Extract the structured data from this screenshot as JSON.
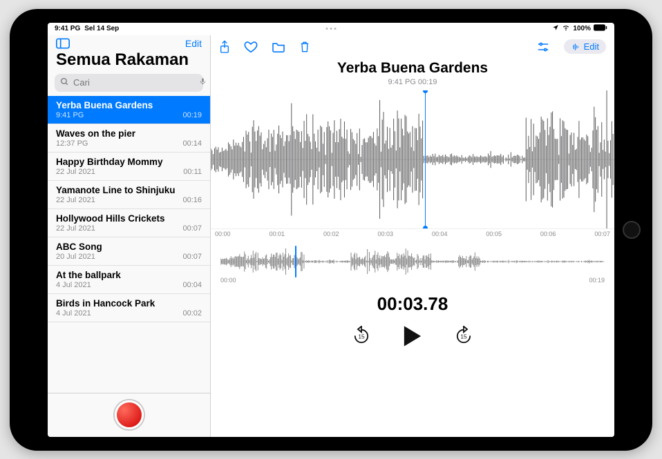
{
  "status": {
    "time": "9:41 PG",
    "date": "Sel 14 Sep",
    "battery": "100%"
  },
  "sidebar": {
    "edit_label": "Edit",
    "title": "Semua Rakaman",
    "search_placeholder": "Cari",
    "items": [
      {
        "title": "Yerba Buena Gardens",
        "meta": "9:41 PG",
        "duration": "00:19"
      },
      {
        "title": "Waves on the pier",
        "meta": "12:37 PG",
        "duration": "00:14"
      },
      {
        "title": "Happy Birthday Mommy",
        "meta": "22 Jul 2021",
        "duration": "00:11"
      },
      {
        "title": "Yamanote Line to Shinjuku",
        "meta": "22 Jul 2021",
        "duration": "00:16"
      },
      {
        "title": "Hollywood Hills Crickets",
        "meta": "22 Jul 2021",
        "duration": "00:07"
      },
      {
        "title": "ABC Song",
        "meta": "20 Jul 2021",
        "duration": "00:07"
      },
      {
        "title": "At the ballpark",
        "meta": "4 Jul 2021",
        "duration": "00:04"
      },
      {
        "title": "Birds in Hancock Park",
        "meta": "4 Jul 2021",
        "duration": "00:02"
      }
    ],
    "selected_index": 0
  },
  "toolbar": {
    "edit_label": "Edit"
  },
  "recording": {
    "title": "Yerba Buena Gardens",
    "subtitle": "9:41 PG  00:19",
    "timer": "00:03.78",
    "timeline_ticks": [
      "00:00",
      "00:01",
      "00:02",
      "00:03",
      "00:04",
      "00:05",
      "00:06",
      "00:07"
    ],
    "scrub_start": "00:00",
    "scrub_end": "00:19",
    "skip_amount": "15"
  }
}
